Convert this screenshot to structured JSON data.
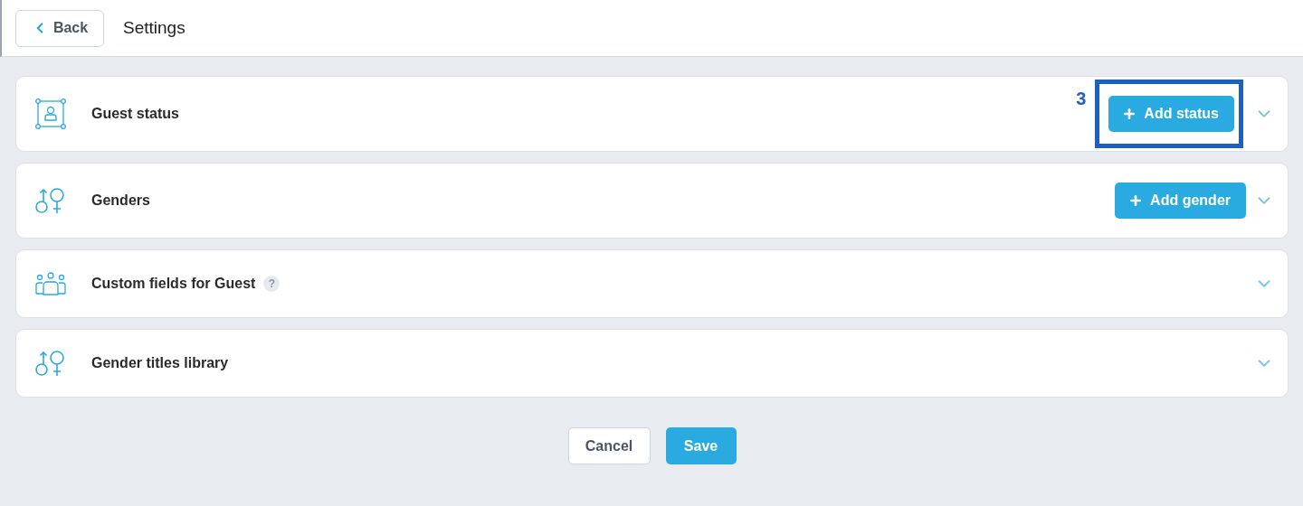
{
  "header": {
    "back_button": "Back",
    "title": "Settings"
  },
  "sections": [
    {
      "kind": "status",
      "title": "Guest status",
      "action": "Add status",
      "annotation": "3",
      "expanded": false
    },
    {
      "kind": "gender",
      "title": "Genders",
      "action": "Add gender",
      "expanded": false
    },
    {
      "kind": "people",
      "title": "Custom fields for Guest",
      "help": "?",
      "expanded": false
    },
    {
      "kind": "gender",
      "title": "Gender titles library",
      "expanded": false
    }
  ],
  "footer": {
    "cancel": "Cancel",
    "save": "Save"
  }
}
